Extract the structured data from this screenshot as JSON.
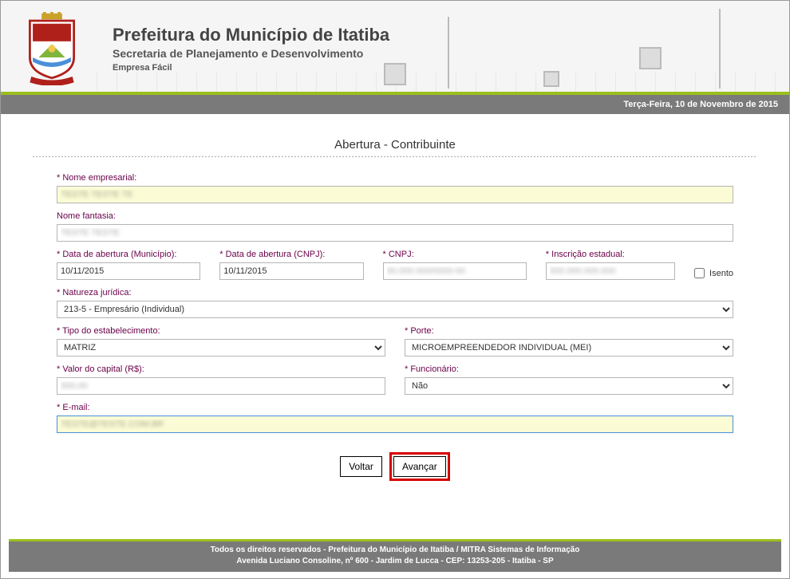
{
  "header": {
    "title": "Prefeitura do Município de Itatiba",
    "subtitle": "Secretaria de Planejamento e Desenvolvimento",
    "appname": "Empresa Fácil"
  },
  "datebar": "Terça-Feira, 10 de Novembro de 2015",
  "page_title": "Abertura - Contribuinte",
  "form": {
    "nome_empresarial": {
      "label": "* Nome empresarial:",
      "value": "TESTE TESTE TE"
    },
    "nome_fantasia": {
      "label": "Nome fantasia:",
      "value": "TESTE TESTE"
    },
    "data_municipio": {
      "label": "* Data de abertura (Município):",
      "value": "10/11/2015"
    },
    "data_cnpj": {
      "label": "* Data de abertura (CNPJ):",
      "value": "10/11/2015"
    },
    "cnpj": {
      "label": "* CNPJ:",
      "value": "00.000.000/0000-00"
    },
    "inscricao": {
      "label": "* Inscrição estadual:",
      "value": "000.000.000.000"
    },
    "isento": {
      "label": "Isento"
    },
    "natureza": {
      "label": "* Natureza jurídica:",
      "value": "213-5 - Empresário (Individual)"
    },
    "tipo": {
      "label": "* Tipo do estabelecimento:",
      "value": "MATRIZ"
    },
    "porte": {
      "label": "* Porte:",
      "value": "MICROEMPREENDEDOR INDIVIDUAL (MEI)"
    },
    "capital": {
      "label": "* Valor do capital (R$):",
      "value": "000,00"
    },
    "funcionario": {
      "label": "* Funcionário:",
      "value": "Não"
    },
    "email": {
      "label": "* E-mail:",
      "value": "TESTE@TESTE.COM.BR"
    }
  },
  "buttons": {
    "back": "Voltar",
    "next": "Avançar"
  },
  "footer": {
    "line1": "Todos os direitos reservados - Prefeitura do Município de Itatiba / MITRA Sistemas de Informação",
    "line2": "Avenida Luciano Consoline, nº 600 - Jardim de Lucca - CEP: 13253-205 - Itatiba - SP"
  }
}
